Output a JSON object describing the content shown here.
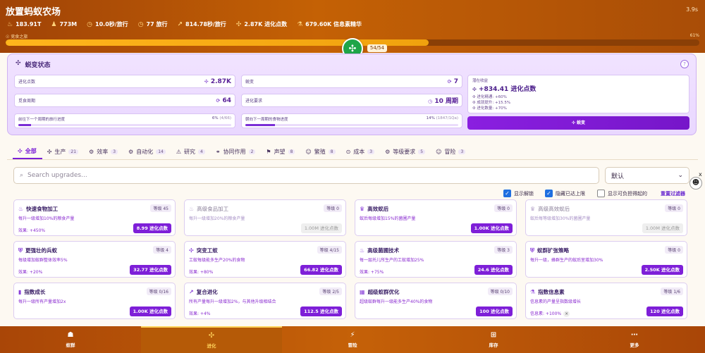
{
  "app": {
    "title": "放置蚂蚁农场",
    "timer": "3.9s"
  },
  "stats": [
    {
      "icon": "food-icon",
      "glyph": "♨",
      "value": "183.91T"
    },
    {
      "icon": "ant-icon",
      "glyph": "♟",
      "value": "773M"
    },
    {
      "icon": "clock-icon",
      "glyph": "◷",
      "value": "10.0秒/旅行"
    },
    {
      "icon": "trip-icon",
      "glyph": "◷",
      "value": "77 旅行"
    },
    {
      "icon": "trend-icon",
      "glyph": "↗",
      "value": "814.78秒/旅行"
    },
    {
      "icon": "evolution-icon",
      "glyph": "✣",
      "value": "2.87K 进化点数"
    },
    {
      "icon": "flask-icon",
      "glyph": "⚗",
      "value": "679.60K 信息素精华"
    }
  ],
  "journey": {
    "label": "竞食之旅",
    "percent_text": "61%",
    "percent": 61,
    "counter": "54/54"
  },
  "mutation": {
    "title": "蜕变状态",
    "help": "?",
    "evo_points": {
      "label": "进化点数",
      "value": "2.87K"
    },
    "mutations": {
      "label": "蜕变",
      "value": "7"
    },
    "food_cycle": {
      "label": "觅食周期",
      "value": "64"
    },
    "evo_req": {
      "label": "进化要求",
      "value": "10 周期"
    },
    "next_trip": {
      "label": "前往下一个周期的旅行进度",
      "pct": "6%",
      "detail": "(4/66)",
      "fill": 6
    },
    "next_food": {
      "label": "朝向下一周期的食物进度",
      "pct": "14%",
      "detail": "(1847/1Qa)",
      "fill": 14
    },
    "earnings": {
      "label": "潜在收益",
      "value": "+834.41 进化点数",
      "lines": [
        "进化精通: +60%",
        "成就提升: +15.5%",
        "进化数量: +70%"
      ]
    },
    "button": "蜕变"
  },
  "tabs": [
    {
      "label": "全部",
      "count": "",
      "glyph": "✣"
    },
    {
      "label": "生产",
      "count": "21",
      "glyph": "✣"
    },
    {
      "label": "效率",
      "count": "3",
      "glyph": "⚙"
    },
    {
      "label": "自动化",
      "count": "14",
      "glyph": "⚙"
    },
    {
      "label": "研究",
      "count": "4",
      "glyph": "⚠"
    },
    {
      "label": "协同作用",
      "count": "2",
      "glyph": "⚭"
    },
    {
      "label": "声望",
      "count": "8",
      "glyph": "⚑"
    },
    {
      "label": "繁殖",
      "count": "8",
      "glyph": "☺"
    },
    {
      "label": "成本",
      "count": "3",
      "glyph": "⊙"
    },
    {
      "label": "等级要求",
      "count": "5",
      "glyph": "⚙"
    },
    {
      "label": "冒险",
      "count": "3",
      "glyph": "☺"
    }
  ],
  "search": {
    "placeholder": "Search upgrades..."
  },
  "sort": {
    "value": "默认"
  },
  "filters": {
    "show_unlocked": "显示解锁",
    "hide_max": "隐藏已达上限",
    "show_affordable": "显示可负担得起的",
    "reset": "重置过滤器"
  },
  "cards": [
    {
      "name": "快速食物加工",
      "level": "等级 45",
      "desc": "每升一级增加10%的粮食产量",
      "effect": "效果: +450%",
      "cost": "8.99 进化点数",
      "dim": false,
      "glyph": "♨"
    },
    {
      "name": "高级食品加工",
      "level": "等级 0",
      "desc": "每升一级增加20%的粮食产量",
      "effect": "",
      "cost": "1.00M 进化点数",
      "dim": true,
      "glyph": "♨"
    },
    {
      "name": "高效蚁后",
      "level": "等级 0",
      "desc": "蚁后每级增加15%的菌圃产量",
      "effect": "",
      "cost": "1.00K 进化点数",
      "dim": false,
      "glyph": "♛"
    },
    {
      "name": "高级高效蚁后",
      "level": "等级 0",
      "desc": "蚁后每等级增加30%的菌圃产量",
      "effect": "",
      "cost": "1.00M 进化点数",
      "dim": true,
      "glyph": "♛"
    },
    {
      "name": "更强壮的兵蚁",
      "level": "等级 4",
      "desc": "每级增加蚁群整体效率5%",
      "effect": "效果: +20%",
      "cost": "32.77 进化点数",
      "dim": false,
      "glyph": "⛨"
    },
    {
      "name": "突变工蚁",
      "level": "等级 4/15",
      "desc": "工蚁每级能多生产20%的食物",
      "effect": "效果: +80%",
      "cost": "66.82 进化点数",
      "dim": false,
      "glyph": "✣"
    },
    {
      "name": "高级菌圃技术",
      "level": "等级 3",
      "desc": "每一层托儿所生产的工蚁增加25%",
      "effect": "效果: +75%",
      "cost": "24.6 进化点数",
      "dim": false,
      "glyph": "♨"
    },
    {
      "name": "蚁群扩张策略",
      "level": "等级 0",
      "desc": "每升一级，蜂群生产的蚁后室增加30%",
      "effect": "",
      "cost": "2.50K 进化点数",
      "dim": false,
      "glyph": "⛨"
    },
    {
      "name": "指数成长",
      "level": "等级 0/16",
      "desc": "每升一级所有产量增加2x",
      "effect": "",
      "cost": "1.00K 进化点数",
      "dim": false,
      "glyph": "▮"
    },
    {
      "name": "复合进化",
      "level": "等级 2/5",
      "desc": "所有产量每升一级增加2%，与其他升级相结合",
      "effect": "效果: +4%",
      "cost": "112.5 进化点数",
      "dim": false,
      "glyph": "↗"
    },
    {
      "name": "超级蚁群优化",
      "level": "等级 0/10",
      "desc": "超级蚁群每升一级能多生产40%的食物",
      "effect": "",
      "cost": "100 进化点数",
      "dim": false,
      "glyph": "▦"
    },
    {
      "name": "指数信息素",
      "level": "等级 1/6",
      "desc": "信息素的产量呈指数级增长",
      "effect": "信息素: +100%",
      "cost": "120 进化点数",
      "dim": false,
      "glyph": "⚗"
    }
  ],
  "nav": [
    {
      "label": "蚁群",
      "glyph": "☗"
    },
    {
      "label": "进化",
      "glyph": "✣"
    },
    {
      "label": "冒险",
      "glyph": "⚡"
    },
    {
      "label": "库存",
      "glyph": "⊞"
    },
    {
      "label": "更多",
      "glyph": "⋯"
    }
  ],
  "side": {
    "close": "x",
    "face": "☻"
  }
}
